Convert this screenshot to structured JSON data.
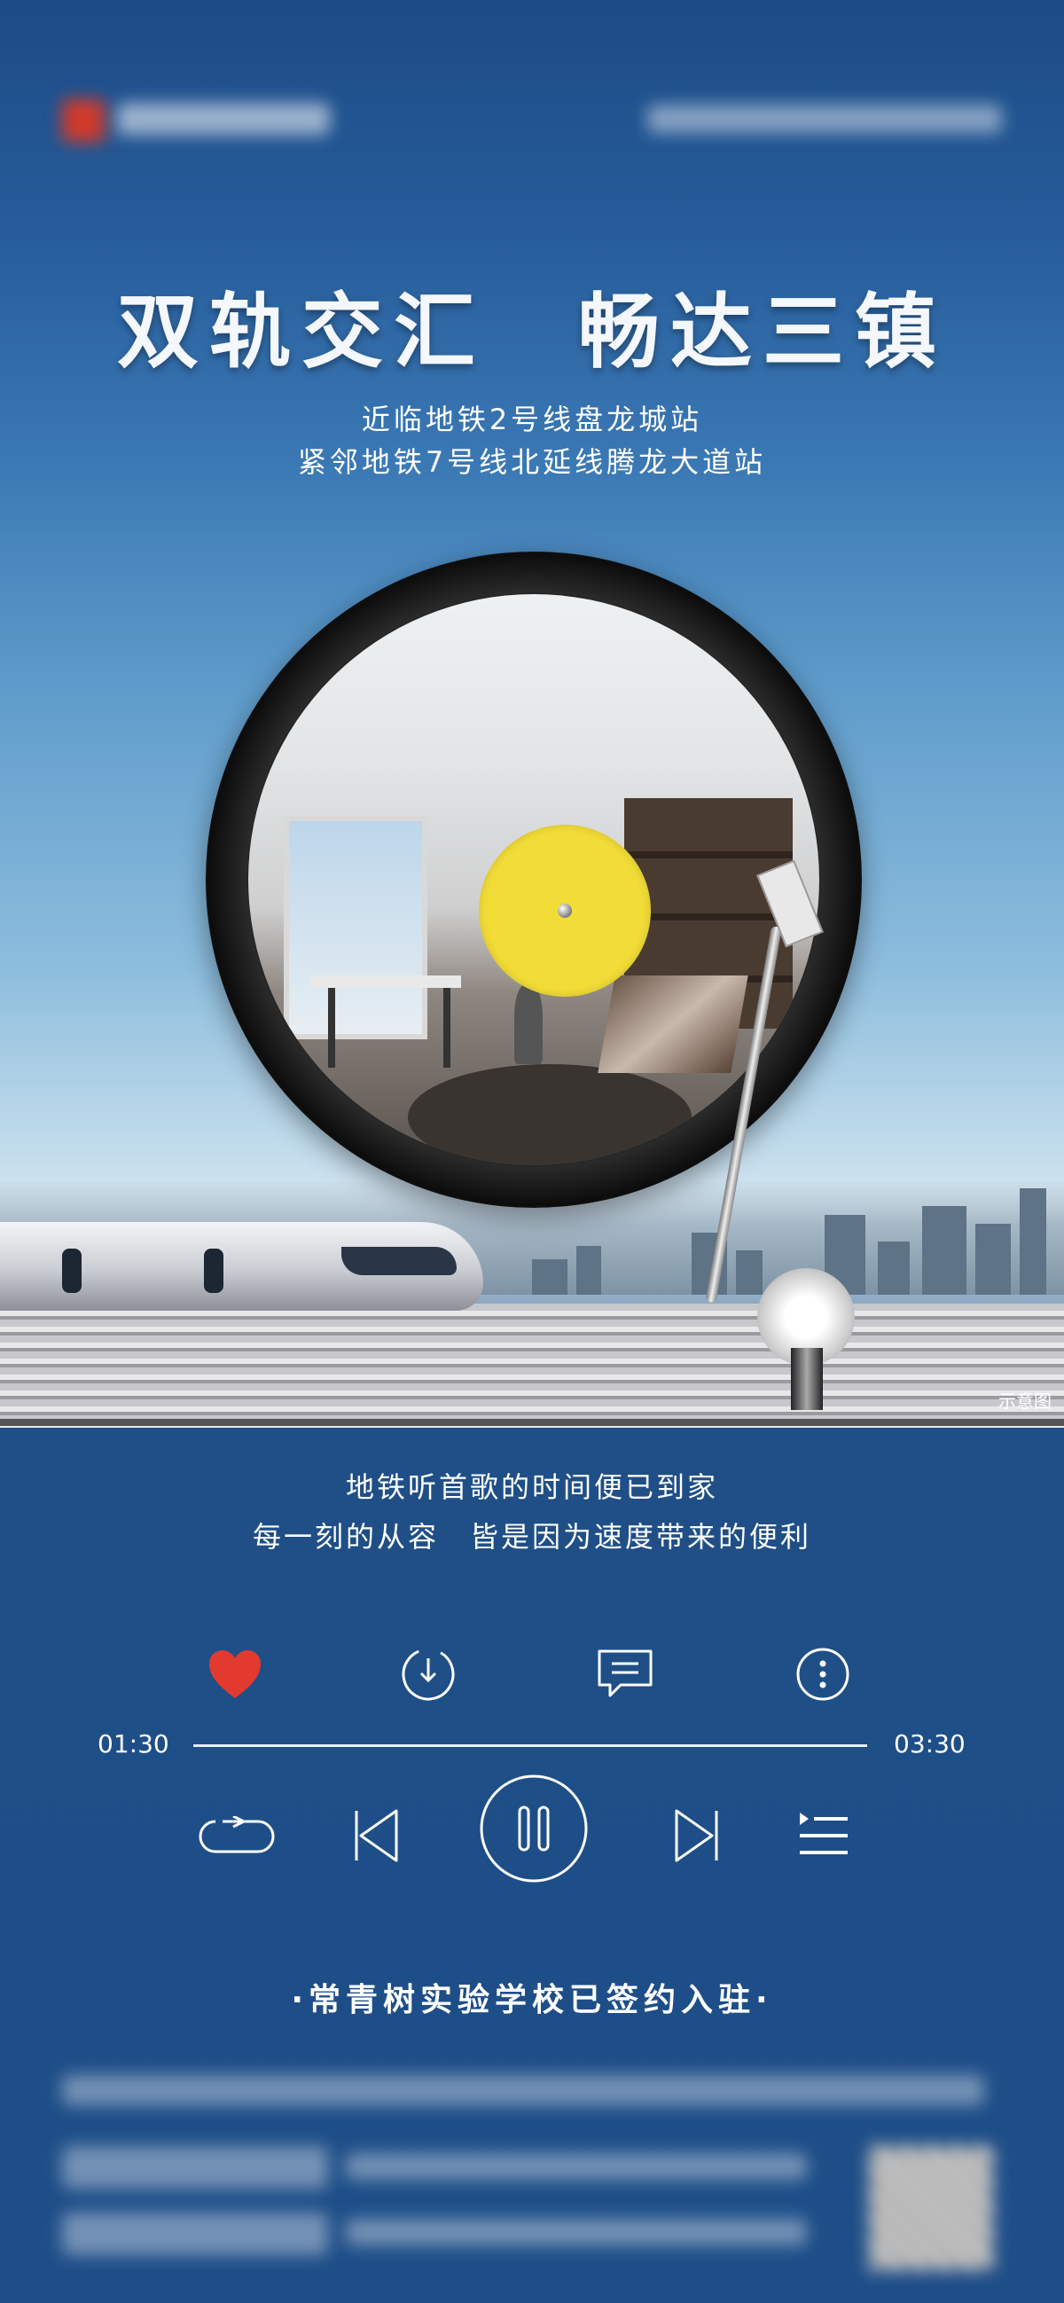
{
  "headline": "双轨交汇　畅达三镇",
  "subtitle": {
    "line1": "近临地铁2号线盘龙城站",
    "line2": "紧邻地铁7号线北延线腾龙大道站"
  },
  "image_caption": "示意图",
  "lyrics": {
    "line1": "地铁听首歌的时间便已到家",
    "line2": "每一刻的从容　皆是因为速度带来的便利"
  },
  "player": {
    "current_time": "01:30",
    "total_time": "03:30",
    "progress_fraction": 0.43,
    "like_color": "#e23a2e",
    "icons": [
      "heart-icon",
      "download-icon",
      "comment-icon",
      "more-icon",
      "repeat-icon",
      "previous-icon",
      "pause-icon",
      "next-icon",
      "playlist-icon"
    ]
  },
  "bottom_tagline": "·常青树实验学校已签约入驻·",
  "colors": {
    "background": "#1f4f86",
    "record_label": "#f2dc37",
    "text": "#ffffff"
  }
}
